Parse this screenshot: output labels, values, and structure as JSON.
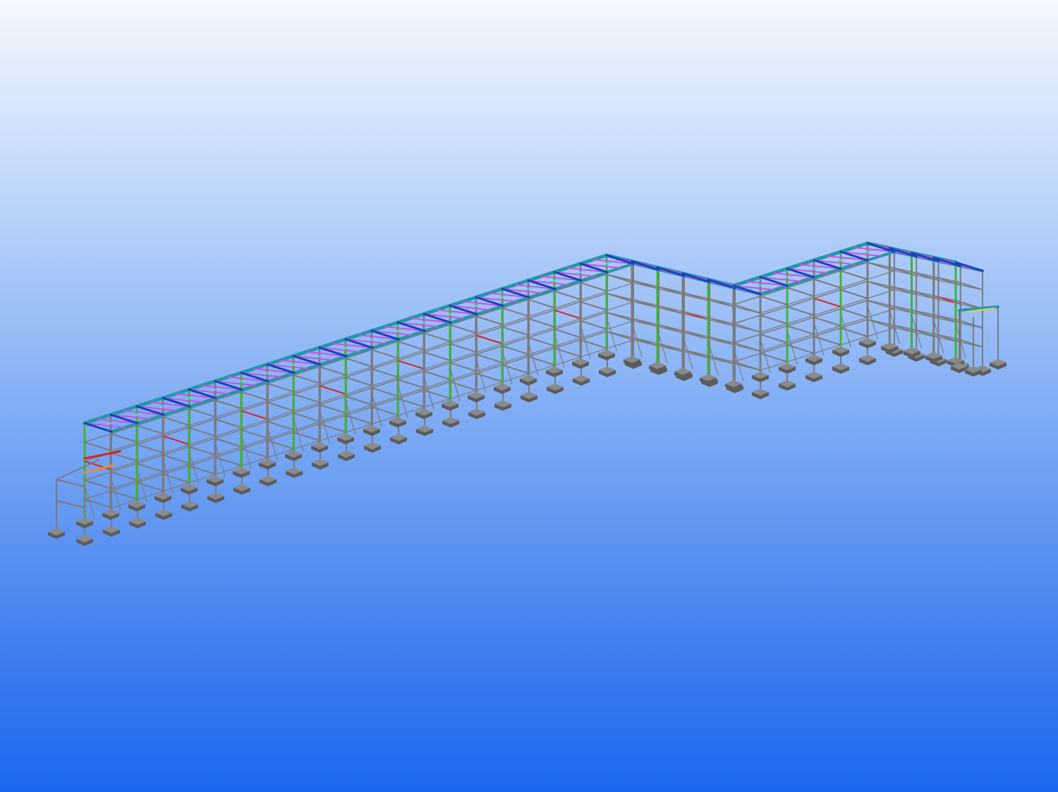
{
  "viewport": {
    "background_top": "#f4f8fe",
    "background_bottom": "#1d68f0"
  },
  "model": {
    "colors": {
      "steel_gray": "#7b7b7b",
      "footing": "#5c5c5c",
      "column_green": "#3fb533",
      "beam_teal": "#1f9aa8",
      "beam_cyan": "#5fd8e0",
      "beam_blue": "#1b3fbf",
      "brace_magenta": "#d04fe0",
      "member_red": "#d8241f",
      "member_orange": "#f08a2a",
      "member_yellow": "#e8d22a"
    }
  }
}
